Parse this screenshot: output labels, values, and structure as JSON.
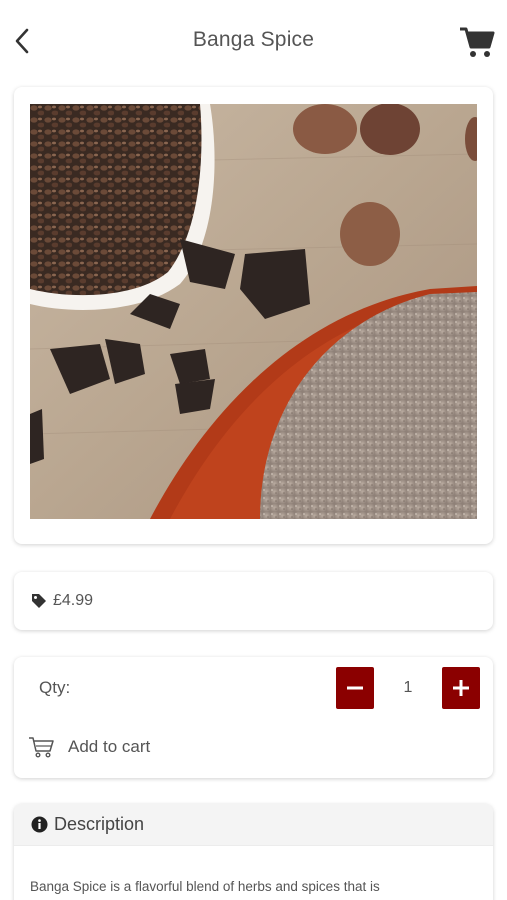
{
  "header": {
    "title": "Banga Spice",
    "back_icon": "chevron-left-icon",
    "cart_icon": "shopping-cart-icon"
  },
  "product": {
    "image_alt": "Banga Spice product photo"
  },
  "price": {
    "icon": "price-tag-icon",
    "value": "£4.99"
  },
  "quantity": {
    "label": "Qty:",
    "value": "1",
    "minus_icon": "minus-icon",
    "plus_icon": "plus-icon",
    "accent_color": "#8b0000"
  },
  "add_to_cart": {
    "icon": "cart-outline-icon",
    "label": "Add to cart"
  },
  "description": {
    "icon": "info-circle-icon",
    "title": "Description",
    "text": "Banga Spice is a flavorful blend of herbs and spices that is"
  }
}
